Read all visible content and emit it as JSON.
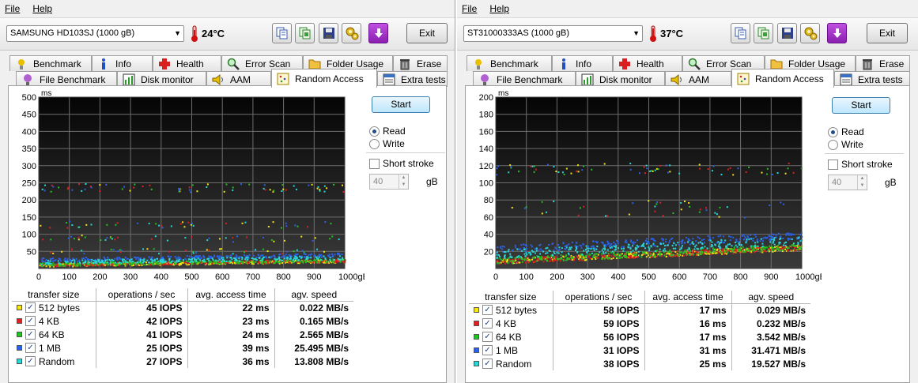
{
  "colors": {
    "plot_bg": "#0b0b0b",
    "grid": "#7a7a7a",
    "s512": "#f5e60f",
    "s4k": "#e02020",
    "s64k": "#22c222",
    "s1m": "#2a62ea",
    "srandom": "#28d8d8"
  },
  "windows": [
    {
      "menu": {
        "file": "File",
        "help": "Help"
      },
      "drive": "SAMSUNG HD103SJ (1000 gB)",
      "temperature": "24°C",
      "exit_label": "Exit",
      "toolbar_icons": [
        "copy-text-icon",
        "copy-info-icon",
        "save-icon",
        "options-icon",
        "download-icon"
      ],
      "tabs_top": [
        {
          "label": "Benchmark",
          "icon": "benchmark-icon"
        },
        {
          "label": "Info",
          "icon": "info-icon"
        },
        {
          "label": "Health",
          "icon": "health-icon"
        },
        {
          "label": "Error Scan",
          "icon": "error-scan-icon"
        },
        {
          "label": "Folder Usage",
          "icon": "folder-icon"
        },
        {
          "label": "Erase",
          "icon": "erase-icon"
        }
      ],
      "tabs_bottom": [
        {
          "label": "File Benchmark",
          "icon": "file-benchmark-icon"
        },
        {
          "label": "Disk monitor",
          "icon": "disk-monitor-icon"
        },
        {
          "label": "AAM",
          "icon": "speaker-icon"
        },
        {
          "label": "Random Access",
          "icon": "random-access-icon",
          "active": true
        },
        {
          "label": "Extra tests",
          "icon": "extra-tests-icon"
        }
      ],
      "controls": {
        "start": "Start",
        "read": "Read",
        "write": "Write",
        "mode": "read",
        "short_stroke": "Short stroke",
        "short_stroke_value": "40",
        "short_stroke_unit": "gB"
      },
      "chart_data": {
        "type": "scatter",
        "ylabel": "ms",
        "ylim": [
          0,
          500
        ],
        "yticks": [
          "50",
          "100",
          "150",
          "200",
          "250",
          "300",
          "350",
          "400",
          "450",
          "500"
        ],
        "xlim": [
          0,
          1000
        ],
        "xticks": [
          "0",
          "100",
          "200",
          "300",
          "400",
          "500",
          "600",
          "700",
          "800",
          "900",
          "1000gB"
        ],
        "grid": true,
        "series": [
          {
            "name": "512 bytes",
            "color_key": "s512",
            "base_start": 10,
            "base_end": 22,
            "spread": 9
          },
          {
            "name": "4 KB",
            "color_key": "s4k",
            "base_start": 11,
            "base_end": 23,
            "spread": 9
          },
          {
            "name": "64 KB",
            "color_key": "s64k",
            "base_start": 12,
            "base_end": 24,
            "spread": 10
          },
          {
            "name": "1 MB",
            "color_key": "s1m",
            "base_start": 25,
            "base_end": 40,
            "spread": 11
          },
          {
            "name": "Random",
            "color_key": "srandom",
            "base_start": 18,
            "base_end": 32,
            "spread": 12
          }
        ],
        "outlier_bands": [
          {
            "from": 225,
            "to": 250
          },
          {
            "from": 120,
            "to": 140
          },
          {
            "from": 80,
            "to": 100
          },
          {
            "from": 45,
            "to": 60
          }
        ]
      },
      "results": {
        "headers": [
          "transfer size",
          "operations / sec",
          "avg. access time",
          "agv. speed"
        ],
        "rows": [
          {
            "size": "512 bytes",
            "color_key": "s512",
            "ops": "45 IOPS",
            "access": "22 ms",
            "speed": "0.022 MB/s"
          },
          {
            "size": "4 KB",
            "color_key": "s4k",
            "ops": "42 IOPS",
            "access": "23 ms",
            "speed": "0.165 MB/s"
          },
          {
            "size": "64 KB",
            "color_key": "s64k",
            "ops": "41 IOPS",
            "access": "24 ms",
            "speed": "2.565 MB/s"
          },
          {
            "size": "1 MB",
            "color_key": "s1m",
            "ops": "25 IOPS",
            "access": "39 ms",
            "speed": "25.495 MB/s"
          },
          {
            "size": "Random",
            "color_key": "srandom",
            "ops": "27 IOPS",
            "access": "36 ms",
            "speed": "13.808 MB/s"
          }
        ]
      }
    },
    {
      "menu": {
        "file": "File",
        "help": "Help"
      },
      "drive": "ST31000333AS (1000 gB)",
      "temperature": "37°C",
      "exit_label": "Exit",
      "toolbar_icons": [
        "copy-text-icon",
        "copy-info-icon",
        "save-icon",
        "options-icon",
        "download-icon"
      ],
      "tabs_top": [
        {
          "label": "Benchmark",
          "icon": "benchmark-icon"
        },
        {
          "label": "Info",
          "icon": "info-icon"
        },
        {
          "label": "Health",
          "icon": "health-icon"
        },
        {
          "label": "Error Scan",
          "icon": "error-scan-icon"
        },
        {
          "label": "Folder Usage",
          "icon": "folder-icon"
        },
        {
          "label": "Erase",
          "icon": "erase-icon"
        }
      ],
      "tabs_bottom": [
        {
          "label": "File Benchmark",
          "icon": "file-benchmark-icon"
        },
        {
          "label": "Disk monitor",
          "icon": "disk-monitor-icon"
        },
        {
          "label": "AAM",
          "icon": "speaker-icon"
        },
        {
          "label": "Random Access",
          "icon": "random-access-icon",
          "active": true
        },
        {
          "label": "Extra tests",
          "icon": "extra-tests-icon"
        }
      ],
      "controls": {
        "start": "Start",
        "read": "Read",
        "write": "Write",
        "mode": "read",
        "short_stroke": "Short stroke",
        "short_stroke_value": "40",
        "short_stroke_unit": "gB"
      },
      "chart_data": {
        "type": "scatter",
        "ylabel": "ms",
        "ylim": [
          0,
          200
        ],
        "yticks": [
          "20",
          "40",
          "60",
          "80",
          "100",
          "120",
          "140",
          "160",
          "180",
          "200"
        ],
        "xlim": [
          0,
          1000
        ],
        "xticks": [
          "0",
          "100",
          "200",
          "300",
          "400",
          "500",
          "600",
          "700",
          "800",
          "900",
          "1000gB"
        ],
        "grid": true,
        "series": [
          {
            "name": "512 bytes",
            "color_key": "s512",
            "base_start": 8,
            "base_end": 24,
            "spread": 6
          },
          {
            "name": "4 KB",
            "color_key": "s4k",
            "base_start": 8,
            "base_end": 24,
            "spread": 6
          },
          {
            "name": "64 KB",
            "color_key": "s64k",
            "base_start": 9,
            "base_end": 25,
            "spread": 7
          },
          {
            "name": "1 MB",
            "color_key": "s1m",
            "base_start": 22,
            "base_end": 38,
            "spread": 9
          },
          {
            "name": "Random",
            "color_key": "srandom",
            "base_start": 16,
            "base_end": 32,
            "spread": 10
          }
        ],
        "outlier_bands": [
          {
            "from": 110,
            "to": 125
          },
          {
            "from": 60,
            "to": 80
          }
        ]
      },
      "results": {
        "headers": [
          "transfer size",
          "operations / sec",
          "avg. access time",
          "agv. speed"
        ],
        "rows": [
          {
            "size": "512 bytes",
            "color_key": "s512",
            "ops": "58 IOPS",
            "access": "17 ms",
            "speed": "0.029 MB/s"
          },
          {
            "size": "4 KB",
            "color_key": "s4k",
            "ops": "59 IOPS",
            "access": "16 ms",
            "speed": "0.232 MB/s"
          },
          {
            "size": "64 KB",
            "color_key": "s64k",
            "ops": "56 IOPS",
            "access": "17 ms",
            "speed": "3.542 MB/s"
          },
          {
            "size": "1 MB",
            "color_key": "s1m",
            "ops": "31 IOPS",
            "access": "31 ms",
            "speed": "31.471 MB/s"
          },
          {
            "size": "Random",
            "color_key": "srandom",
            "ops": "38 IOPS",
            "access": "25 ms",
            "speed": "19.527 MB/s"
          }
        ]
      }
    }
  ]
}
